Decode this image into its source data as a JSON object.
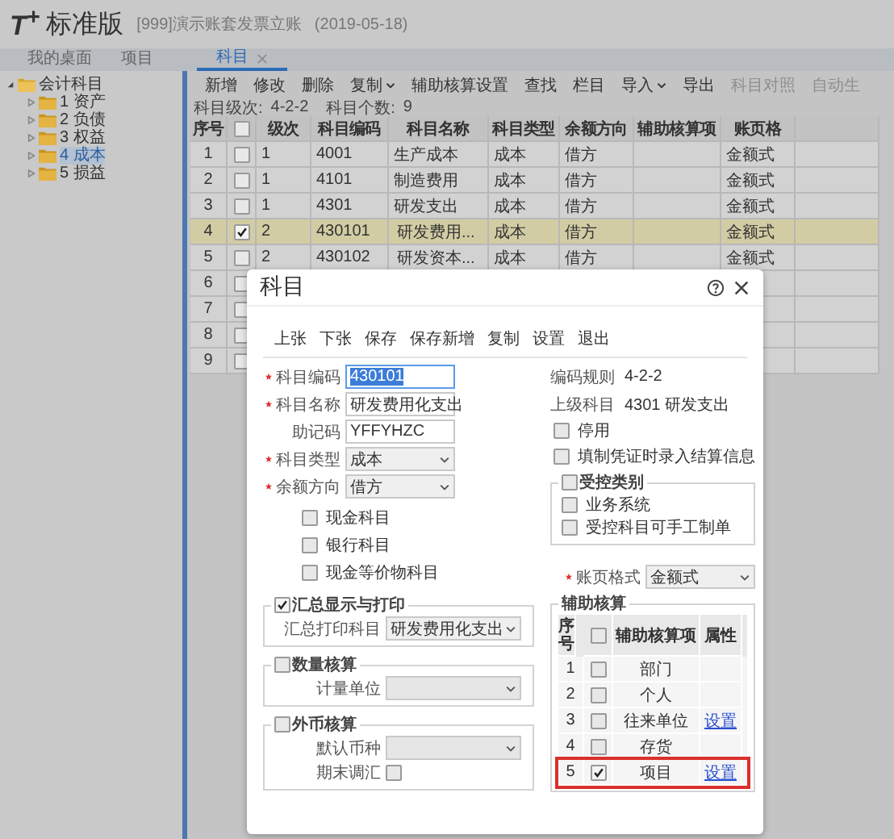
{
  "header": {
    "logo": "T$^{+}$",
    "product": "标准版",
    "account": "[999]演示账套发票立账",
    "date": "(2019-05-18)"
  },
  "tabs": [
    {
      "label": "我的桌面",
      "selected": false,
      "closable": false
    },
    {
      "label": "项目",
      "selected": false,
      "closable": false
    },
    {
      "label": "科目",
      "selected": true,
      "closable": true
    }
  ],
  "tree": {
    "label": "会计科目",
    "expanded": true,
    "selected": false,
    "children": [
      {
        "label": "1 资产",
        "expanded": false,
        "selected": false
      },
      {
        "label": "2 负债",
        "expanded": false,
        "selected": false
      },
      {
        "label": "3 权益",
        "expanded": false,
        "selected": false
      },
      {
        "label": "4 成本",
        "expanded": false,
        "selected": true
      },
      {
        "label": "5 损益",
        "expanded": false,
        "selected": false
      }
    ]
  },
  "toolbar": [
    {
      "label": "新增",
      "dropdown": false,
      "disabled": false
    },
    {
      "label": "修改",
      "dropdown": false,
      "disabled": false
    },
    {
      "label": "删除",
      "dropdown": false,
      "disabled": false
    },
    {
      "label": "复制",
      "dropdown": true,
      "disabled": false
    },
    {
      "label": "辅助核算设置",
      "dropdown": false,
      "disabled": false
    },
    {
      "label": "查找",
      "dropdown": false,
      "disabled": false
    },
    {
      "label": "栏目",
      "dropdown": false,
      "disabled": false
    },
    {
      "label": "导入",
      "dropdown": true,
      "disabled": false
    },
    {
      "label": "导出",
      "dropdown": false,
      "disabled": false
    },
    {
      "label": "科目对照",
      "dropdown": false,
      "disabled": true
    },
    {
      "label": "自动生",
      "dropdown": false,
      "disabled": true
    }
  ],
  "info": {
    "levels_label": "科目级次:",
    "levels": "4-2-2",
    "count_label": "科目个数:",
    "count": "9"
  },
  "table": {
    "columns": [
      {
        "kind": "text",
        "label": "序号"
      },
      {
        "kind": "checkbox",
        "checked": false
      },
      {
        "kind": "text",
        "label": "级次"
      },
      {
        "kind": "text",
        "label": "科目编码"
      },
      {
        "kind": "text",
        "label": "科目名称"
      },
      {
        "kind": "text",
        "label": "科目类型"
      },
      {
        "kind": "text",
        "label": "余额方向"
      },
      {
        "kind": "text",
        "label": "辅助核算项"
      },
      {
        "kind": "text",
        "label": "账页格"
      }
    ],
    "rows": [
      {
        "seq": "1",
        "checked": false,
        "selected": false,
        "level": "1",
        "code": "4001",
        "name": "生产成本",
        "type": "成本",
        "direction": "借方",
        "format": "金额式"
      },
      {
        "seq": "2",
        "checked": false,
        "selected": false,
        "level": "1",
        "code": "4101",
        "name": "制造费用",
        "type": "成本",
        "direction": "借方",
        "format": "金额式"
      },
      {
        "seq": "3",
        "checked": false,
        "selected": false,
        "level": "1",
        "code": "4301",
        "name": "研发支出",
        "type": "成本",
        "direction": "借方",
        "format": "金额式"
      },
      {
        "seq": "4",
        "checked": true,
        "selected": true,
        "level": "2",
        "code": "430101",
        "name": "研发费用...",
        "type": "成本",
        "direction": "借方",
        "format": "金额式"
      },
      {
        "seq": "5",
        "checked": false,
        "selected": false,
        "level": "2",
        "code": "430102",
        "name": "研发资本...",
        "type": "成本",
        "direction": "借方",
        "format": "金额式"
      },
      {
        "seq": "6",
        "checked": false,
        "selected": false
      },
      {
        "seq": "7",
        "checked": false,
        "selected": false
      },
      {
        "seq": "8",
        "checked": false,
        "selected": false
      },
      {
        "seq": "9",
        "checked": false,
        "selected": false
      }
    ]
  },
  "dialog": {
    "title": "科目",
    "toolbar": [
      "上张",
      "下张",
      "保存",
      "保存新增",
      "复制",
      "设置",
      "退出"
    ],
    "fields": [
      {
        "label": "科目编码",
        "required": true,
        "kind": "input",
        "value": "430101",
        "selected": true
      },
      {
        "label": "科目名称",
        "required": true,
        "kind": "input",
        "value": "研发费用化支出",
        "selected": false
      },
      {
        "label": "助记码",
        "required": false,
        "kind": "input",
        "value": "YFFYHZC",
        "selected": false
      },
      {
        "label": "科目类型",
        "required": true,
        "kind": "select",
        "value": "成本",
        "selected": false
      },
      {
        "label": "余额方向",
        "required": true,
        "kind": "select",
        "value": "借方",
        "selected": false
      }
    ],
    "options": [
      {
        "label": "现金科目",
        "checked": false
      },
      {
        "label": "银行科目",
        "checked": false
      },
      {
        "label": "现金等价物科目",
        "checked": false
      }
    ],
    "summary": {
      "label": "汇总显示与打印",
      "checked": true,
      "field_label": "汇总打印科目",
      "value": "研发费用化支出"
    },
    "quantity": {
      "label": "数量核算",
      "checked": false,
      "field_label": "计量单位"
    },
    "currency": {
      "label": "外币核算",
      "checked": false,
      "field_label": "默认币种",
      "adjust_label": "期末调汇",
      "adjust_checked": false
    },
    "rule_label": "编码规则",
    "rule": "4-2-2",
    "parent_label": "上级科目",
    "parent": "4301 研发支出",
    "flags": [
      {
        "label": "停用",
        "checked": false
      },
      {
        "label": "填制凭证时录入结算信息",
        "checked": false
      }
    ],
    "control": {
      "label": "受控类别",
      "checked": false,
      "items": [
        {
          "label": "业务系统",
          "checked": false
        },
        {
          "label": "受控科目可手工制单",
          "checked": false
        }
      ]
    },
    "format": {
      "label": "账页格式",
      "required": true,
      "value": "金额式"
    },
    "aux": {
      "label": "辅助核算",
      "columns": [
        {
          "kind": "text",
          "label": "序号"
        },
        {
          "kind": "checkbox",
          "checked": false
        },
        {
          "kind": "text",
          "label": "辅助核算项"
        },
        {
          "kind": "text",
          "label": "属性"
        }
      ],
      "rows": [
        {
          "seq": "1",
          "checked": false,
          "item": "部门",
          "highlighted": false
        },
        {
          "seq": "2",
          "checked": false,
          "item": "个人",
          "highlighted": false
        },
        {
          "seq": "3",
          "checked": false,
          "item": "往来单位",
          "link": "设置",
          "highlighted": false
        },
        {
          "seq": "4",
          "checked": false,
          "item": "存货",
          "highlighted": false
        },
        {
          "seq": "5",
          "checked": true,
          "item": "项目",
          "link": "设置",
          "highlighted": true
        }
      ]
    }
  }
}
